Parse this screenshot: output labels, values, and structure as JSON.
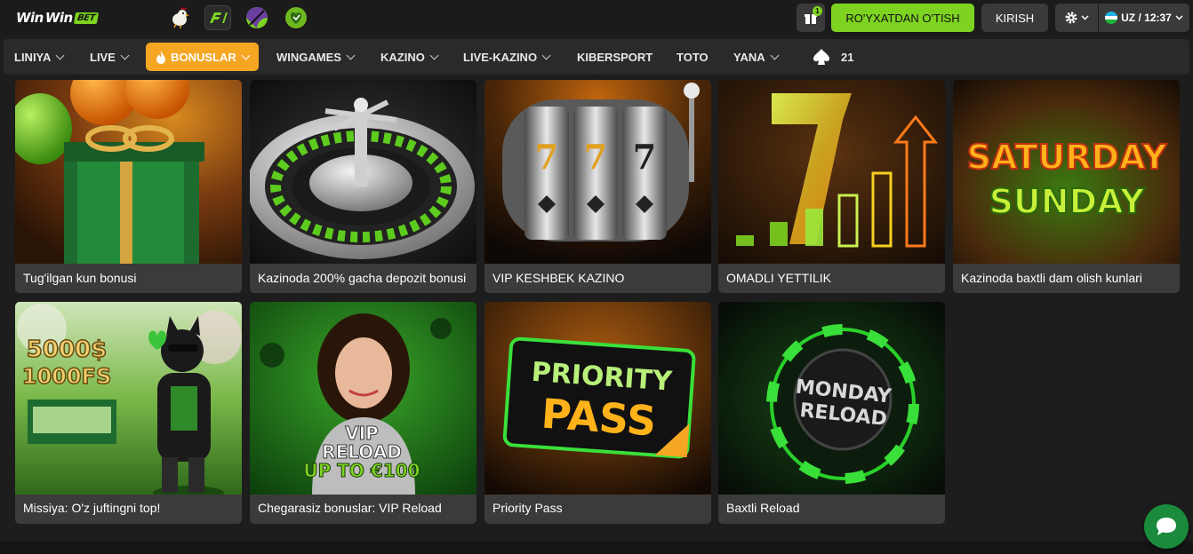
{
  "header": {
    "logo_word1": "Win",
    "logo_word2": "Win",
    "logo_badge": "BET",
    "gift_count": "1",
    "register_label": "RO'YXATDAN O'TISH",
    "login_label": "KIRISH",
    "lang_label": "UZ / 12:37"
  },
  "nav": {
    "items": [
      {
        "label": "LINIYA",
        "dropdown": true
      },
      {
        "label": "LIVE",
        "dropdown": true
      },
      {
        "label": "BONUSLAR",
        "dropdown": true,
        "active": true
      },
      {
        "label": "WINGAMES",
        "dropdown": true
      },
      {
        "label": "KAZINO",
        "dropdown": true
      },
      {
        "label": "LIVE-KAZINO",
        "dropdown": true
      },
      {
        "label": "KIBERSPORT",
        "dropdown": false
      },
      {
        "label": "TOTO",
        "dropdown": false
      },
      {
        "label": "YANA",
        "dropdown": true
      }
    ],
    "counter": "21"
  },
  "cards": [
    {
      "caption": "Tug'ilgan kun bonusi",
      "icon": "gift-icon"
    },
    {
      "caption": "Kazinoda 200% gacha depozit bonusi",
      "icon": "roulette-icon"
    },
    {
      "caption": "VIP KESHBEK KAZINO",
      "icon": "slot-machine-icon"
    },
    {
      "caption": "OMADLI YETTILIK",
      "icon": "lucky-seven-icon"
    },
    {
      "caption": "Kazinoda baxtli dam olish kunlari",
      "icon": "weekend-icon",
      "art_text1": "SATURDAY",
      "art_text2": "SUNDAY"
    },
    {
      "caption": "Missiya: O'z juftingni top!",
      "icon": "cat-icon",
      "art_text1": "5000$",
      "art_text2": "1000FS"
    },
    {
      "caption": "Chegarasiz bonuslar: VIP Reload",
      "icon": "woman-icon",
      "art_text1": "VIP",
      "art_text2": "RELOAD",
      "art_text3": "UP TO €100"
    },
    {
      "caption": "Priority Pass",
      "icon": "ticket-icon",
      "art_text1": "PRIORITY",
      "art_text2": "PASS"
    },
    {
      "caption": "Baxtli Reload",
      "icon": "chip-icon",
      "art_text1": "MONDAY",
      "art_text2": "RELOAD"
    }
  ],
  "colors": {
    "accent_green": "#7ed321",
    "accent_orange": "#f5a623",
    "background": "#1d1d1d",
    "card": "#3b3b3b"
  }
}
